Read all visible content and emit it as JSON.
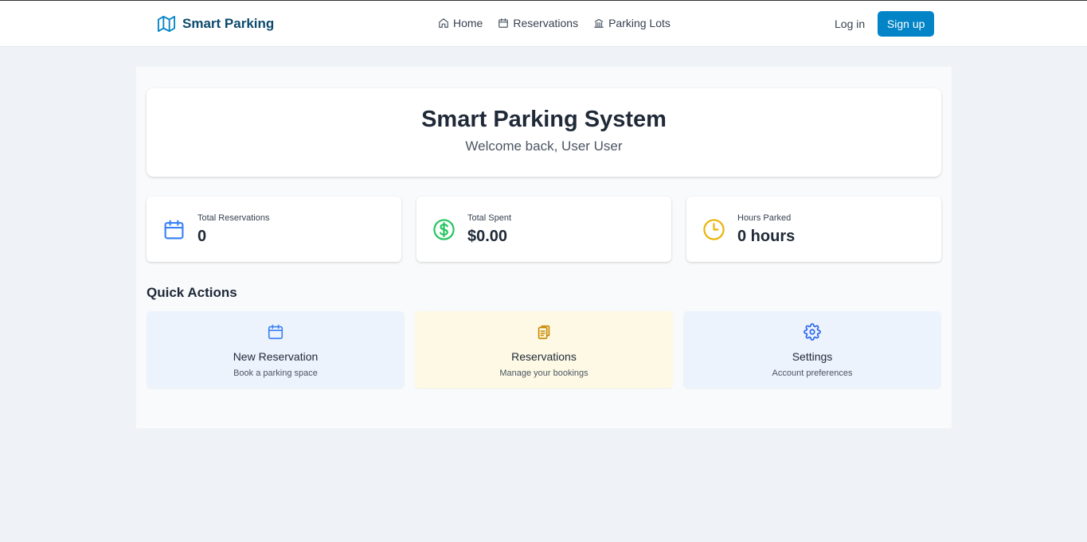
{
  "navbar": {
    "brand": "Smart Parking",
    "links": [
      {
        "label": "Home",
        "icon": "home-icon"
      },
      {
        "label": "Reservations",
        "icon": "calendar-icon"
      },
      {
        "label": "Parking Lots",
        "icon": "building-icon"
      }
    ],
    "login_label": "Log in",
    "signup_label": "Sign up"
  },
  "hero": {
    "title": "Smart Parking System",
    "subtitle": "Welcome back, User User"
  },
  "stats": [
    {
      "label": "Total Reservations",
      "value": "0",
      "icon": "calendar-icon",
      "color": "#3b82f6"
    },
    {
      "label": "Total Spent",
      "value": "$0.00",
      "icon": "dollar-icon",
      "color": "#22c55e"
    },
    {
      "label": "Hours Parked",
      "value": "0 hours",
      "icon": "clock-icon",
      "color": "#eab308"
    }
  ],
  "quick_actions": {
    "title": "Quick Actions",
    "items": [
      {
        "title": "New Reservation",
        "subtitle": "Book a parking space",
        "icon": "calendar-icon",
        "color": "#3b82f6"
      },
      {
        "title": "Reservations",
        "subtitle": "Manage your bookings",
        "icon": "clipboard-icon",
        "color": "#ca8a04"
      },
      {
        "title": "Settings",
        "subtitle": "Account preferences",
        "icon": "gear-icon",
        "color": "#2563eb"
      }
    ]
  },
  "colors": {
    "primary": "#0284c7",
    "brand": "#0c4a6e",
    "background": "#eff3f8"
  }
}
